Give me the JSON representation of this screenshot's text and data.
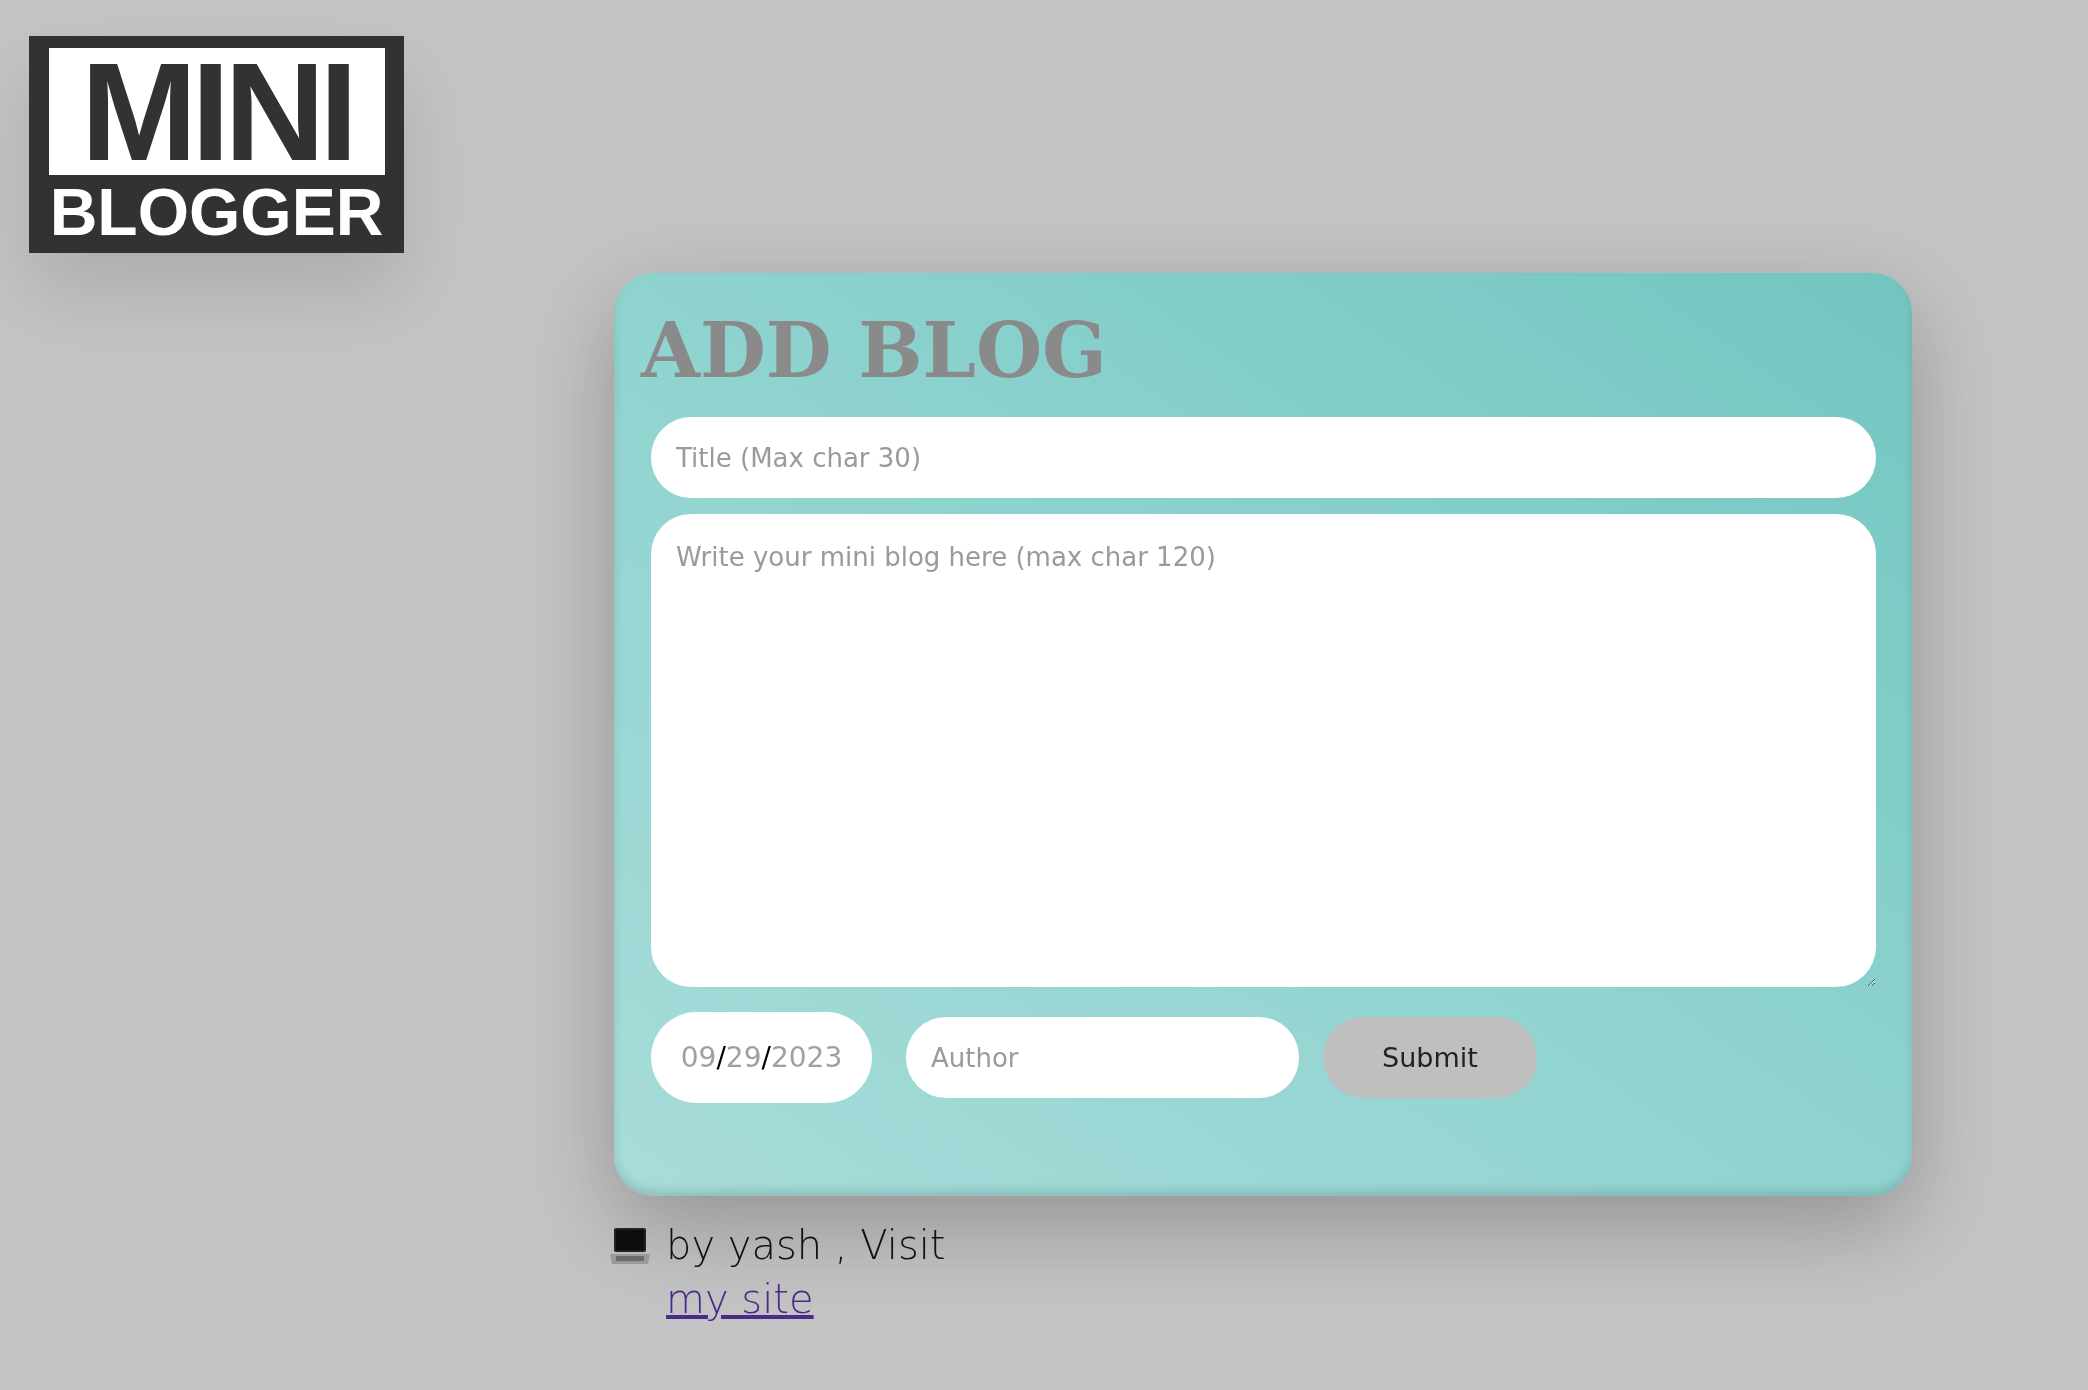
{
  "logo": {
    "top": "MINI",
    "bottom": "BLOGGER"
  },
  "form": {
    "title": "ADD BLOG",
    "title_field": {
      "placeholder": "Title (Max char 30)"
    },
    "body_field": {
      "placeholder": "Write your mini blog here (max char 120)"
    },
    "date_field": {
      "segments": [
        "09",
        "29",
        "2023"
      ],
      "separator": "/"
    },
    "author_field": {
      "placeholder": "Author"
    },
    "submit": "Submit"
  },
  "footer": {
    "text": "by yash , Visit",
    "link": "my site"
  }
}
